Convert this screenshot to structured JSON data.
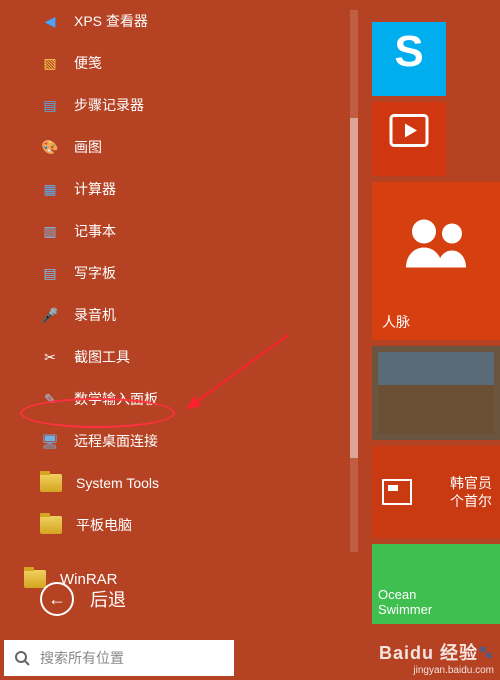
{
  "apps": [
    {
      "icon": "xps",
      "color": "#4aa3ff",
      "label": "XPS 查看器"
    },
    {
      "icon": "note",
      "color": "#f7c94b",
      "label": "便笺"
    },
    {
      "icon": "steps",
      "color": "#3b8fd6",
      "label": "步骤记录器"
    },
    {
      "icon": "paint",
      "color": "#c97bd6",
      "label": "画图"
    },
    {
      "icon": "calc",
      "color": "#4a78d6",
      "label": "计算器"
    },
    {
      "icon": "notepad",
      "color": "#5fa8e6",
      "label": "记事本"
    },
    {
      "icon": "wordpad",
      "color": "#3b8fd6",
      "label": "写字板"
    },
    {
      "icon": "mic",
      "color": "#f05030",
      "label": "录音机"
    },
    {
      "icon": "snip",
      "color": "#f05030",
      "label": "截图工具"
    },
    {
      "icon": "math",
      "color": "#3b8fd6",
      "label": "数学输入面板"
    },
    {
      "icon": "rdp",
      "color": "#3b8fd6",
      "label": "远程桌面连接"
    },
    {
      "icon": "folder",
      "color": "#e6b800",
      "label": "System Tools"
    },
    {
      "icon": "folder",
      "color": "#e6b800",
      "label": "平板电脑"
    }
  ],
  "winrar_label": "WinRAR",
  "back_label": "后退",
  "search_placeholder": "搜索所有位置",
  "tiles": {
    "skype": "S",
    "video_glyph": "▣",
    "people_label": "人脉",
    "news_label": "韩官员\n个首尔",
    "ocean_label": "Ocean\nSwimmer"
  },
  "watermark": {
    "brand": "Baidu 经验",
    "url": "jingyan.baidu.com"
  }
}
